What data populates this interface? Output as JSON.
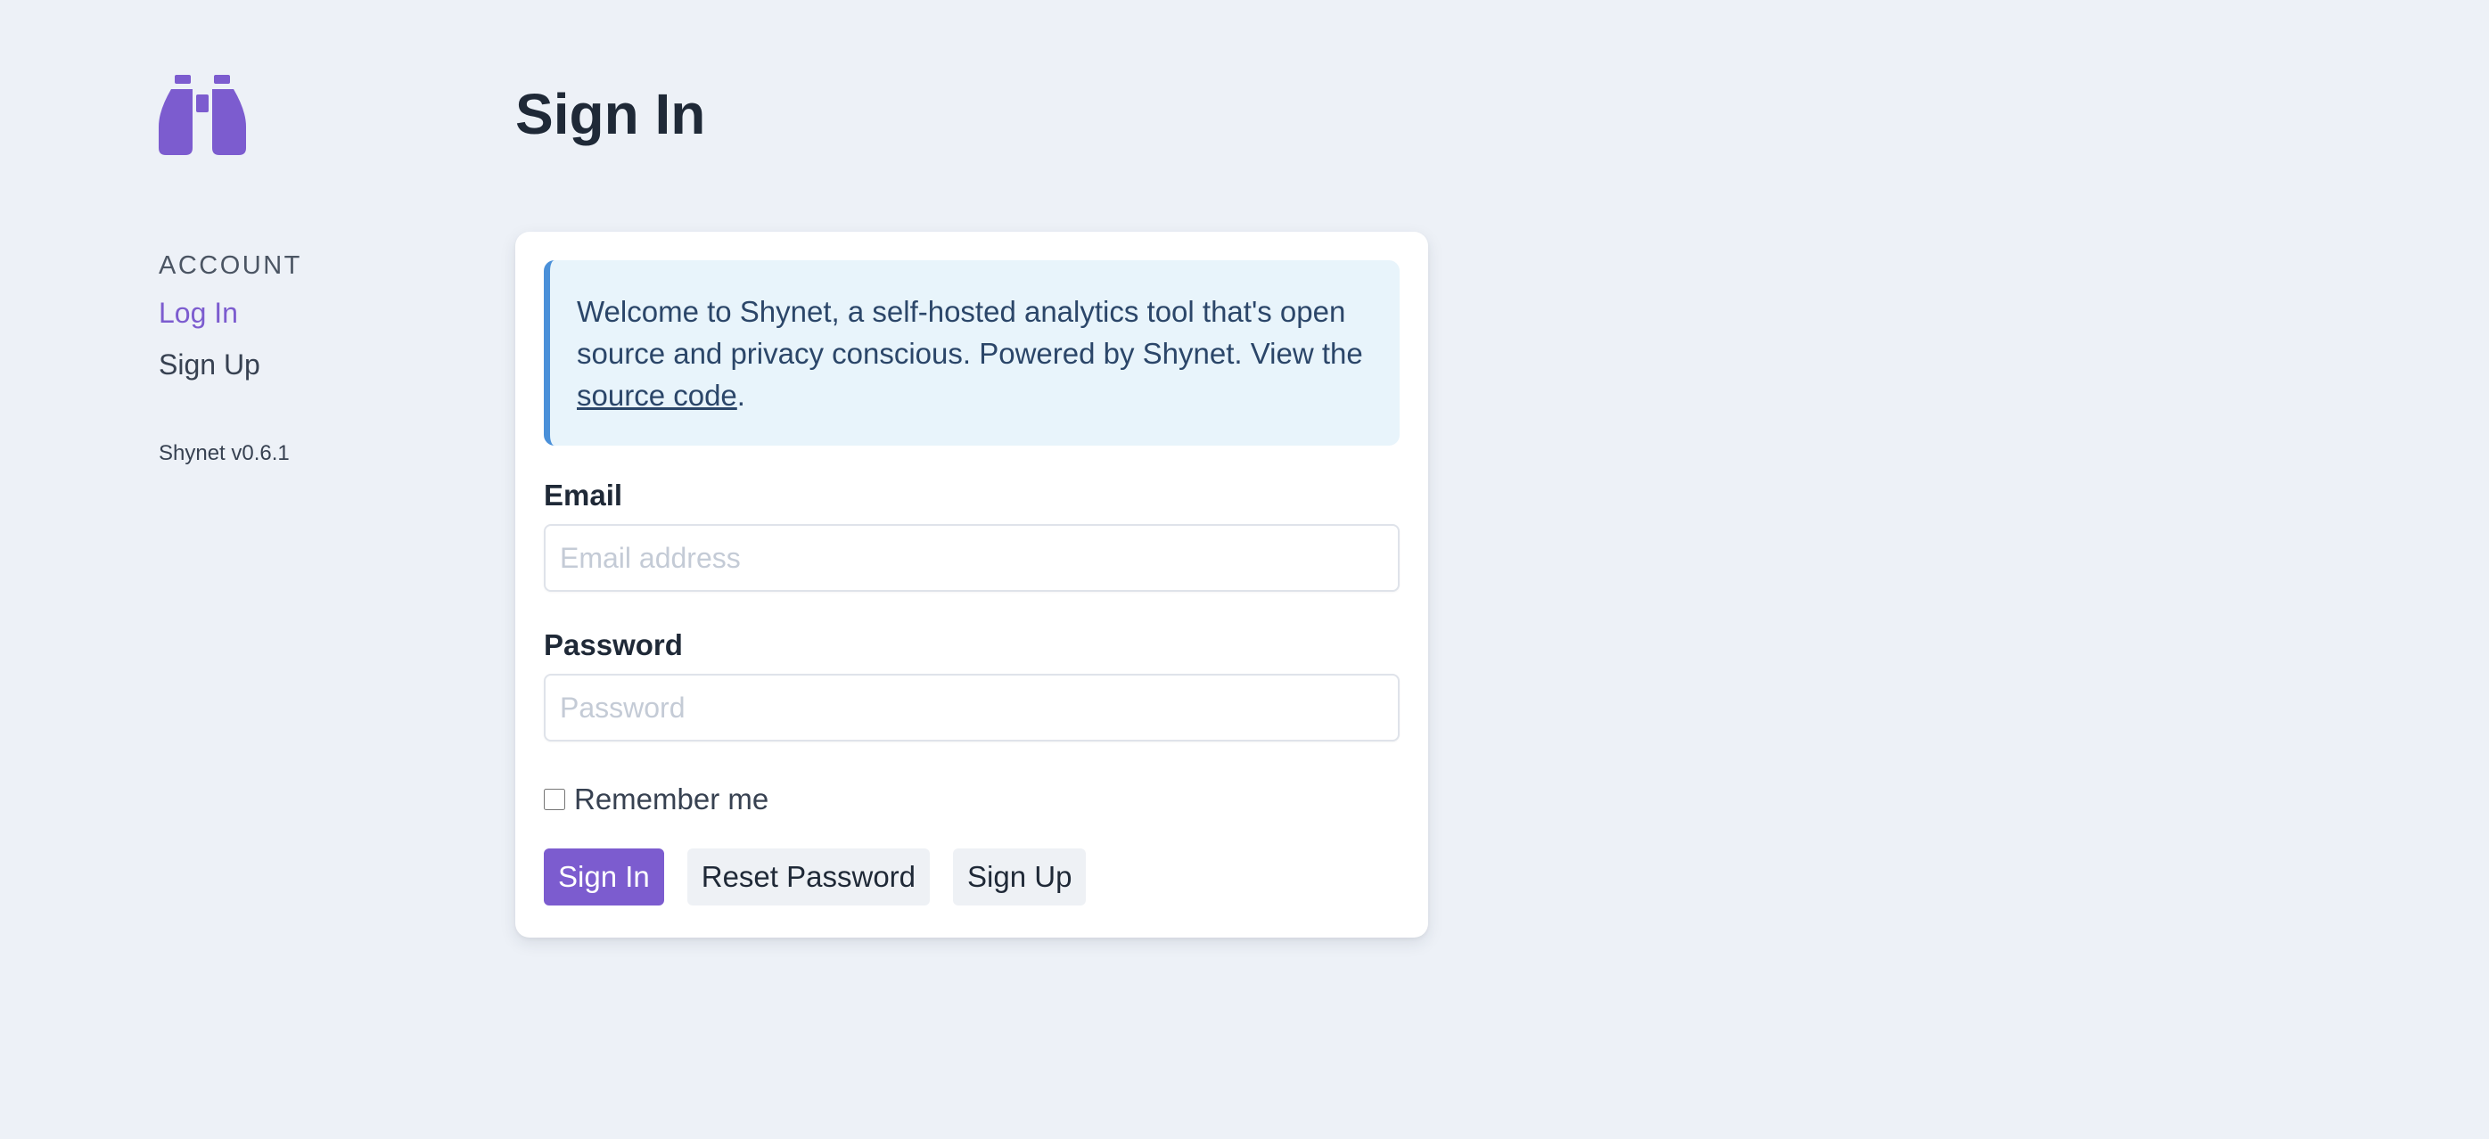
{
  "sidebar": {
    "logo_icon": "binoculars-icon",
    "section_heading": "ACCOUNT",
    "items": [
      {
        "label": "Log In",
        "active": true
      },
      {
        "label": "Sign Up",
        "active": false
      }
    ],
    "version": "Shynet v0.6.1"
  },
  "main": {
    "title": "Sign In",
    "notice": {
      "text_before": "Welcome to Shynet, a self-hosted analytics tool that's open source and privacy conscious. Powered by Shynet. View the ",
      "link_text": "source code",
      "text_after": "."
    },
    "email": {
      "label": "Email",
      "placeholder": "Email address",
      "value": ""
    },
    "password": {
      "label": "Password",
      "placeholder": "Password",
      "value": ""
    },
    "remember": {
      "label": "Remember me",
      "checked": false
    },
    "buttons": {
      "sign_in": "Sign In",
      "reset_password": "Reset Password",
      "sign_up": "Sign Up"
    }
  },
  "colors": {
    "accent": "#7c5ccf",
    "background": "#edf1f7",
    "notice_bg": "#e8f4fb",
    "notice_border": "#4a90d9"
  }
}
